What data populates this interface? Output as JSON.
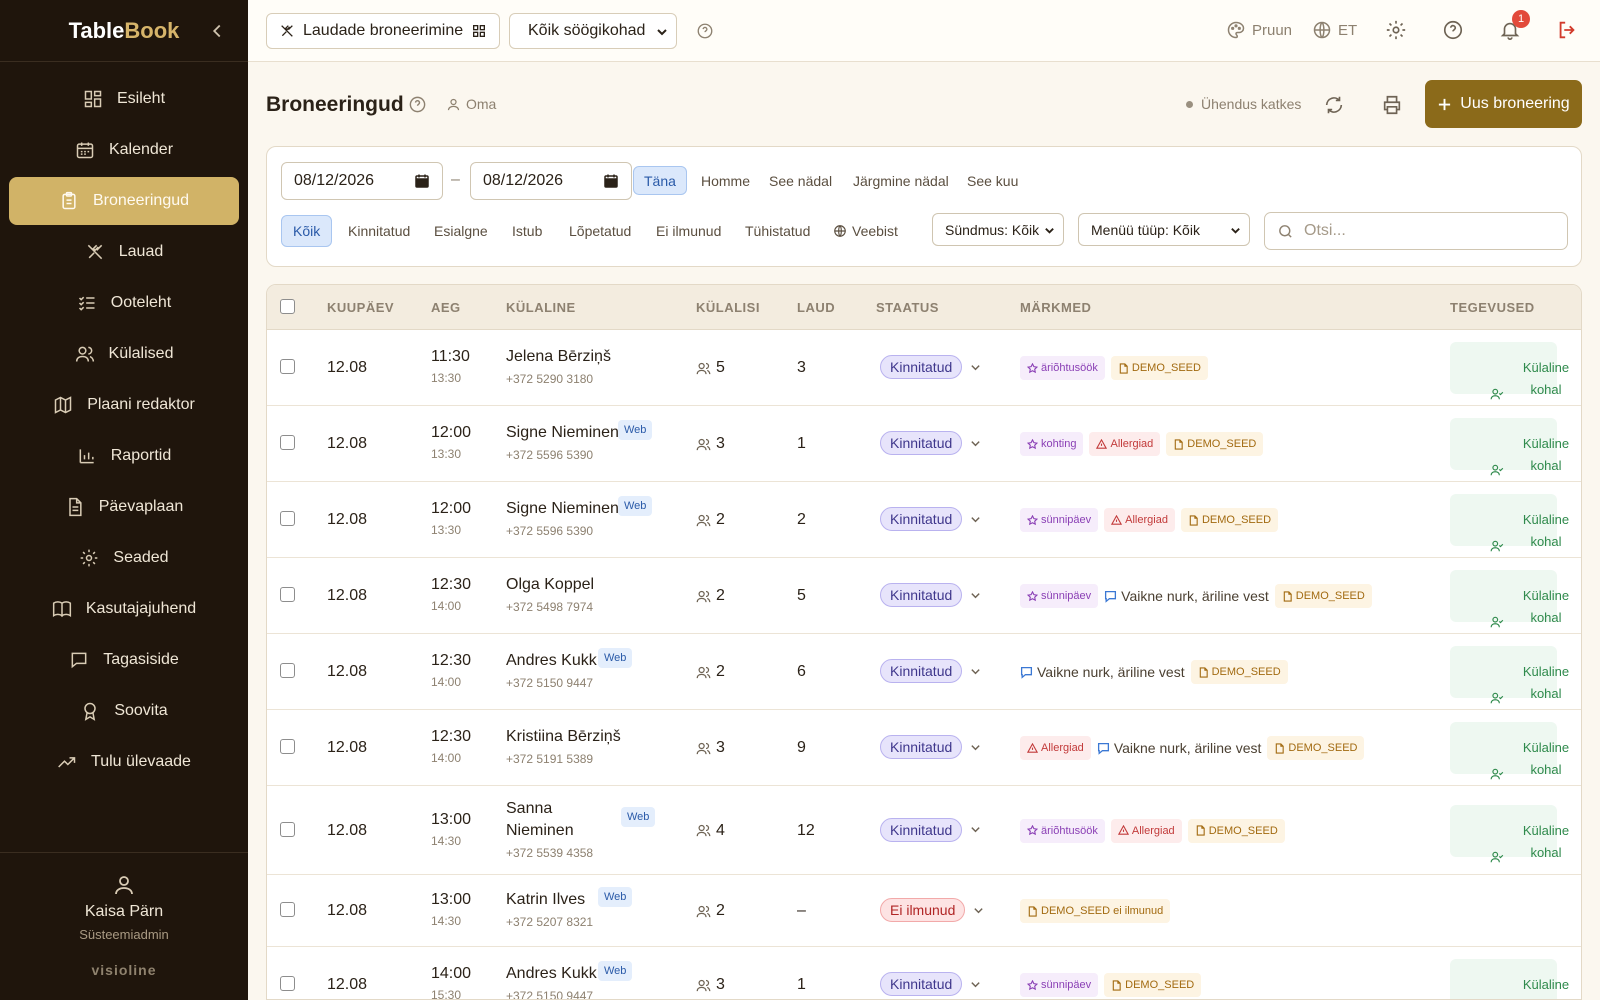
{
  "app": {
    "brand_main": "Table",
    "brand_accent": "Book"
  },
  "sidebar": {
    "items": [
      {
        "label": "Esileht",
        "icon": "dashboard-icon"
      },
      {
        "label": "Kalender",
        "icon": "calendar-icon"
      },
      {
        "label": "Broneeringud",
        "icon": "clipboard-icon",
        "active": true
      },
      {
        "label": "Lauad",
        "icon": "utensils-icon"
      },
      {
        "label": "Ooteleht",
        "icon": "list-check-icon"
      },
      {
        "label": "Külalised",
        "icon": "users-icon"
      },
      {
        "label": "Plaani redaktor",
        "icon": "map-icon"
      },
      {
        "label": "Raportid",
        "icon": "bar-chart-icon"
      },
      {
        "label": "Päevaplaan",
        "icon": "document-icon"
      },
      {
        "label": "Seaded",
        "icon": "gear-icon"
      },
      {
        "label": "Kasutajajuhend",
        "icon": "book-icon"
      },
      {
        "label": "Tagasiside",
        "icon": "chat-icon"
      },
      {
        "label": "Soovita",
        "icon": "award-icon"
      },
      {
        "label": "Tulu ülevaade",
        "icon": "trend-icon"
      }
    ],
    "user": {
      "name": "Kaisa Pärn",
      "role": "Süsteemiadmin"
    },
    "vendor": "visioline"
  },
  "topbar": {
    "module": "Laudade broneerimine",
    "venue": "Kõik söögikohad",
    "theme": "Pruun",
    "language": "ET",
    "notifications": "1"
  },
  "page": {
    "title": "Broneeringud",
    "owner": "Oma",
    "connection": "Ühendus katkes",
    "new_button": "Uus broneering"
  },
  "filters": {
    "date_from": "08/12/2026",
    "date_sep": "–",
    "date_to": "08/12/2026",
    "quick": [
      "Täna",
      "Homme",
      "See nädal",
      "Järgmine nädal",
      "See kuu"
    ],
    "statuses": [
      "Kõik",
      "Kinnitatud",
      "Esialgne",
      "Istub",
      "Lõpetatud",
      "Ei ilmunud",
      "Tühistatud",
      "Veebist"
    ],
    "event_select": "Sündmus: Kõik",
    "menu_select": "Menüü tüüp: Kõik",
    "search_placeholder": "Otsi..."
  },
  "table": {
    "columns": [
      "KUUPÄEV",
      "AEG",
      "KÜLALINE",
      "KÜLALISI",
      "LAUD",
      "STAATUS",
      "MÄRKMED",
      "TEGEVUSED"
    ],
    "action_label_1": "Külaline",
    "action_label_2": "kohal",
    "rows": [
      {
        "date": "12.08",
        "time": "11:30",
        "end": "13:30",
        "name": "Jelena Bērziņš",
        "phone": "+372 5290 3180",
        "web": "",
        "party": "5",
        "table": "3",
        "status": "Kinnitatud",
        "tags": [
          {
            "type": "occasion",
            "text": "äriõhtusöök"
          },
          {
            "type": "demo",
            "text": "DEMO_SEED"
          }
        ],
        "action": true
      },
      {
        "date": "12.08",
        "time": "12:00",
        "end": "13:30",
        "name": "Signe Nieminen",
        "phone": "+372 5596 5390",
        "web": "Web",
        "party": "3",
        "table": "1",
        "status": "Kinnitatud",
        "tags": [
          {
            "type": "occasion",
            "text": "kohting"
          },
          {
            "type": "allergy",
            "text": "Allergiad"
          },
          {
            "type": "demo",
            "text": "DEMO_SEED"
          }
        ],
        "action": true
      },
      {
        "date": "12.08",
        "time": "12:00",
        "end": "13:30",
        "name": "Signe Nieminen",
        "phone": "+372 5596 5390",
        "web": "Web",
        "party": "2",
        "table": "2",
        "status": "Kinnitatud",
        "tags": [
          {
            "type": "occasion",
            "text": "sünnipäev"
          },
          {
            "type": "allergy",
            "text": "Allergiad"
          },
          {
            "type": "demo",
            "text": "DEMO_SEED"
          }
        ],
        "action": true
      },
      {
        "date": "12.08",
        "time": "12:30",
        "end": "14:00",
        "name": "Olga Koppel",
        "phone": "+372 5498 7974",
        "web": "",
        "party": "2",
        "table": "5",
        "status": "Kinnitatud",
        "tags": [
          {
            "type": "occasion",
            "text": "sünnipäev"
          },
          {
            "type": "note",
            "text": "Vaikne nurk, äriline vest"
          },
          {
            "type": "demo",
            "text": "DEMO_SEED"
          }
        ],
        "action": true
      },
      {
        "date": "12.08",
        "time": "12:30",
        "end": "14:00",
        "name": "Andres Kukk",
        "phone": "+372 5150 9447",
        "web": "Web",
        "party": "2",
        "table": "6",
        "status": "Kinnitatud",
        "tags": [
          {
            "type": "note",
            "text": "Vaikne nurk, äriline vest"
          },
          {
            "type": "demo",
            "text": "DEMO_SEED"
          }
        ],
        "action": true
      },
      {
        "date": "12.08",
        "time": "12:30",
        "end": "14:00",
        "name": "Kristiina Bērziņš",
        "phone": "+372 5191 5389",
        "web": "",
        "party": "3",
        "table": "9",
        "status": "Kinnitatud",
        "tags": [
          {
            "type": "allergy",
            "text": "Allergiad"
          },
          {
            "type": "note",
            "text": "Vaikne nurk, äriline vest"
          },
          {
            "type": "demo",
            "text": "DEMO_SEED"
          }
        ],
        "action": true
      },
      {
        "date": "12.08",
        "time": "13:00",
        "end": "14:30",
        "name": "Sanna",
        "name2": "Nieminen",
        "phone": "+372 5539 4358",
        "web": "Web",
        "party": "4",
        "table": "12",
        "status": "Kinnitatud",
        "tags": [
          {
            "type": "occasion",
            "text": "äriõhtusöök"
          },
          {
            "type": "allergy",
            "text": "Allergiad"
          },
          {
            "type": "demo",
            "text": "DEMO_SEED"
          }
        ],
        "action": true
      },
      {
        "date": "12.08",
        "time": "13:00",
        "end": "14:30",
        "name": "Katrin Ilves",
        "phone": "+372 5207 8321",
        "web": "Web",
        "party": "2",
        "table": "–",
        "status": "Ei ilmunud",
        "tags": [
          {
            "type": "demo",
            "text": "DEMO_SEED ei ilmunud"
          }
        ],
        "action": false
      },
      {
        "date": "12.08",
        "time": "14:00",
        "end": "15:30",
        "name": "Andres Kukk",
        "phone": "+372 5150 9447",
        "web": "Web",
        "party": "3",
        "table": "1",
        "status": "Kinnitatud",
        "tags": [
          {
            "type": "occasion",
            "text": "sünnipäev"
          },
          {
            "type": "demo",
            "text": "DEMO_SEED"
          }
        ],
        "action": true
      }
    ]
  }
}
